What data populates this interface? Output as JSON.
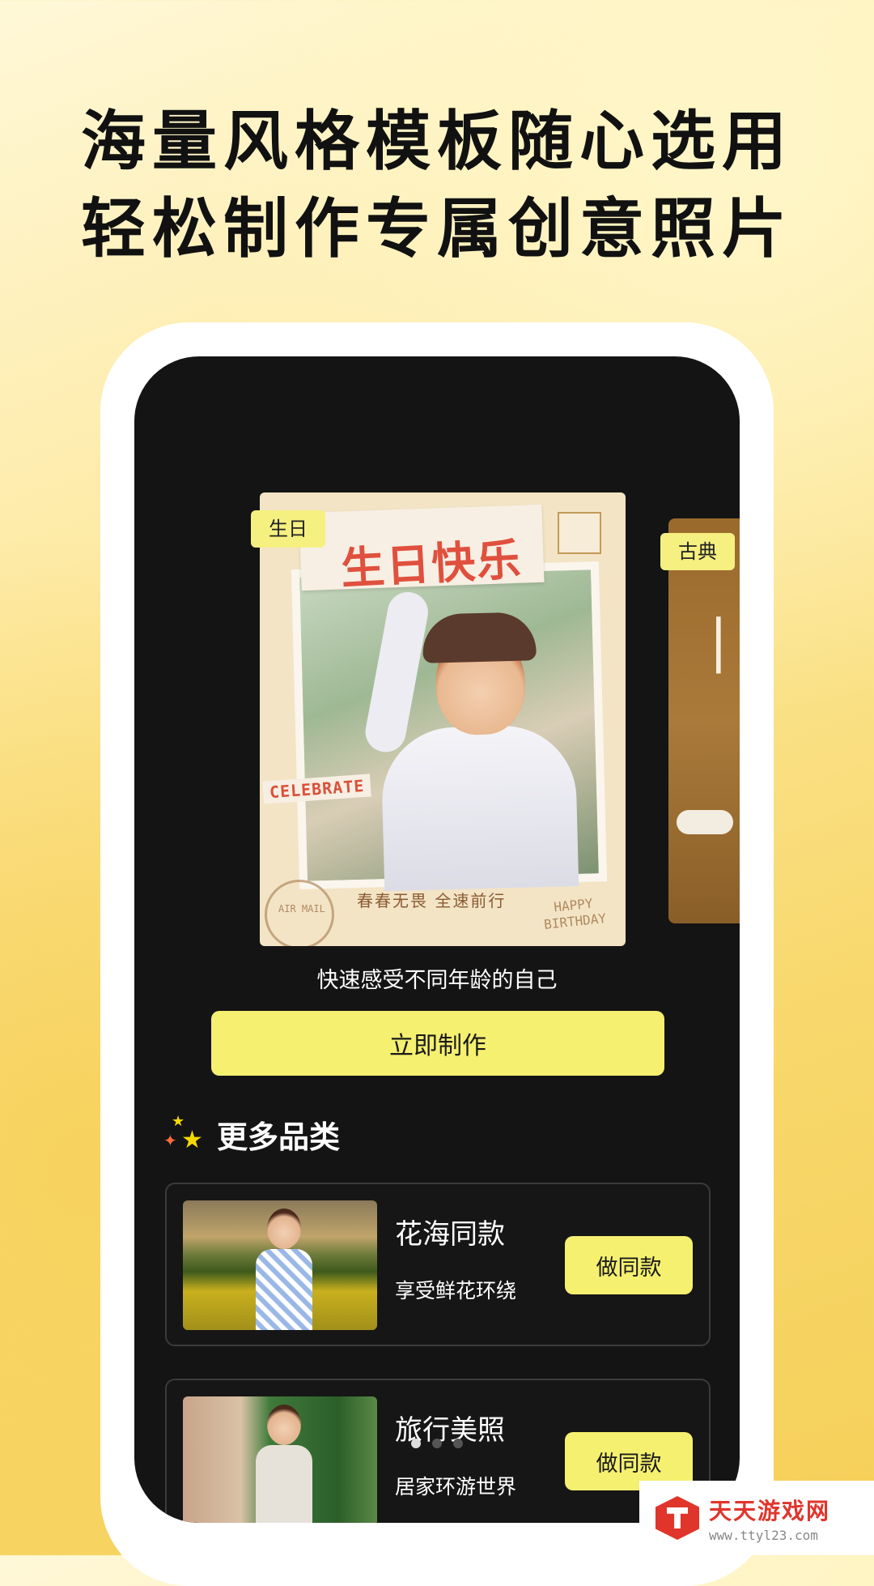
{
  "headline": {
    "line1": "海量风格模板随心选用",
    "line2": "轻松制作专属创意照片"
  },
  "carousel": {
    "active_card": {
      "tag": "生日",
      "title": "生日快乐",
      "badge": "CELEBRATE",
      "caption": "春春无畏 全速前行",
      "note_line1": "HAPPY",
      "note_line2": "BIRTHDAY",
      "stamp": "AIR MAIL"
    },
    "next_card": {
      "tag": "古典"
    },
    "subtitle": "快速感受不同年龄的自己",
    "cta": "立即制作",
    "page_indicator": {
      "count": 3,
      "active_index": 0
    }
  },
  "section": {
    "title": "更多品类",
    "icon": "sparkle-stars-icon"
  },
  "categories": [
    {
      "name": "花海同款",
      "desc": "享受鲜花环绕",
      "button": "做同款"
    },
    {
      "name": "旅行美照",
      "desc": "居家环游世界",
      "button": "做同款"
    }
  ],
  "watermark": {
    "title": "天天游戏网",
    "url": "www.ttyl23.com"
  },
  "colors": {
    "accent_yellow": "#f5f070",
    "screen_bg": "#141414",
    "brand_red": "#e0352b"
  }
}
